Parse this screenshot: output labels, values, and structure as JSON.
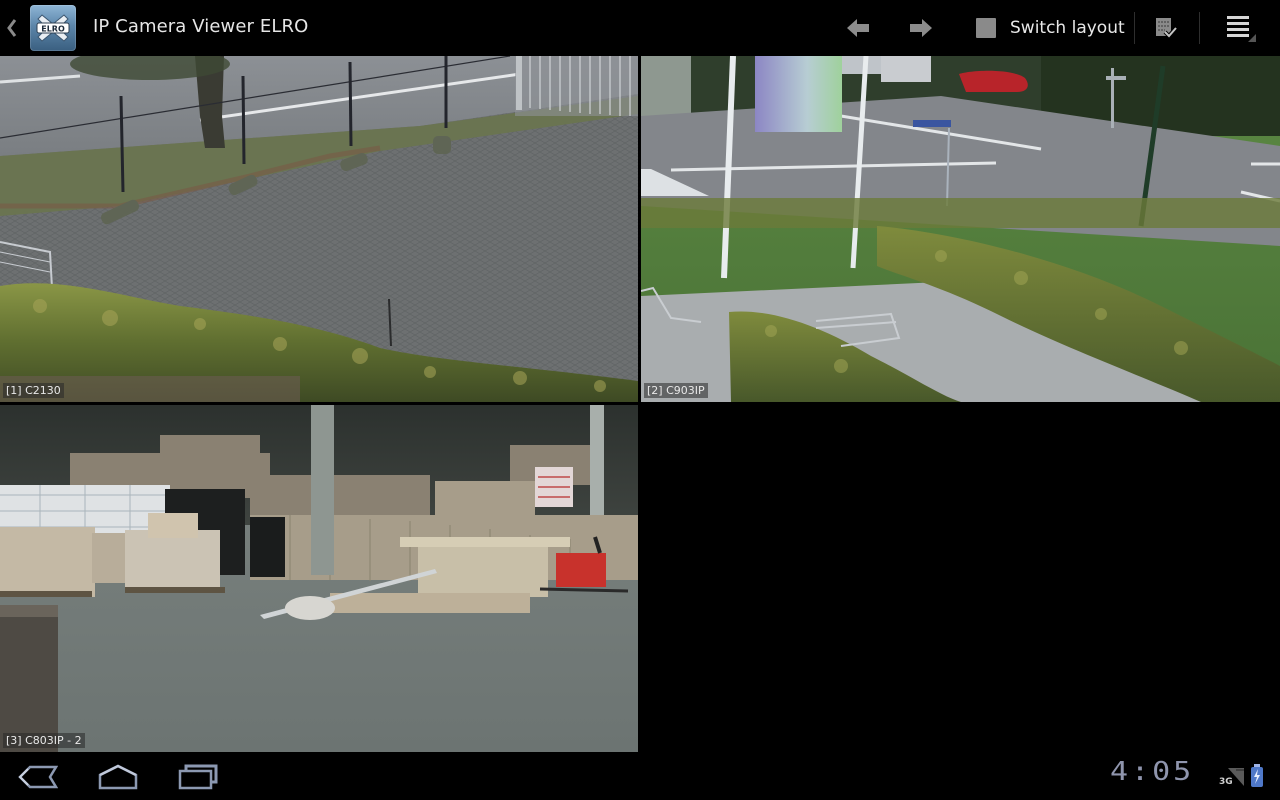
{
  "action_bar": {
    "app_icon": "elro-logo-icon",
    "app_icon_text": "ELRO",
    "title": "IP Camera Viewer ELRO",
    "buttons": {
      "previous": "arrow-left-icon",
      "next": "arrow-right-icon",
      "switch_layout_label": "Switch layout",
      "switch_layout_checked": false,
      "checklist": "checklist-icon",
      "overflow": "overflow-menu-icon"
    }
  },
  "cameras": [
    {
      "index": 1,
      "label": "[1] C2130",
      "scene": "outdoor parking lot with fence, pavement and hedge"
    },
    {
      "index": 2,
      "label": "[2] C903IP",
      "scene": "outdoor road with flagpoles, lawn, hedges and bike racks"
    },
    {
      "index": 3,
      "label": "[3] C803IP - 2",
      "scene": "warehouse interior with pallets of boxes and pallet truck"
    },
    {
      "index": 4,
      "label": "",
      "scene": "empty"
    }
  ],
  "system_bar": {
    "nav": {
      "back": "back-icon",
      "home": "home-icon",
      "recent": "recent-apps-icon"
    },
    "clock": "4:05",
    "network_type": "3G",
    "signal_icon": "signal-icon",
    "battery_icon": "battery-charging-icon"
  }
}
